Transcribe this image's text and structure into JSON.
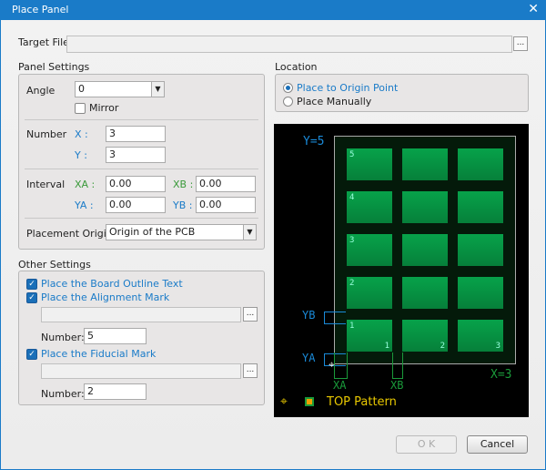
{
  "window": {
    "title": "Place Panel",
    "close": "✕"
  },
  "target_file": {
    "label": "Target File",
    "value": "",
    "browse": "..."
  },
  "panel_settings": {
    "title": "Panel Settings",
    "angle_label": "Angle",
    "angle_value": "0",
    "mirror_label": "Mirror",
    "mirror_checked": false,
    "number_label": "Number",
    "x_label": "X :",
    "x_value": "3",
    "y_label": "Y :",
    "y_value": "3",
    "interval_label": "Interval",
    "xa_label": "XA :",
    "xa_value": "0.00",
    "xb_label": "XB :",
    "xb_value": "0.00",
    "ya_label": "YA :",
    "ya_value": "0.00",
    "yb_label": "YB :",
    "yb_value": "0.00",
    "origin_label": "Placement Origin",
    "origin_value": "Origin of the PCB"
  },
  "other_settings": {
    "title": "Other Settings",
    "board_outline": "Place the Board Outline Text",
    "alignment": "Place the Alignment Mark",
    "alignment_number_label": "Number:",
    "alignment_number": "5",
    "fiducial": "Place the Fiducial Mark",
    "fiducial_number_label": "Number:",
    "fiducial_number": "2",
    "browse": "..."
  },
  "location": {
    "title": "Location",
    "origin": "Place to Origin Point",
    "manual": "Place Manually",
    "selected": "origin"
  },
  "preview": {
    "y_count": "Y=5",
    "x_count": "X=3",
    "row_labels": [
      "5",
      "4",
      "3",
      "2",
      "1"
    ],
    "col_labels": [
      "1",
      "2",
      "3"
    ],
    "xa": "XA",
    "xb": "XB",
    "ya": "YA",
    "yb": "YB",
    "legend": "TOP Pattern"
  },
  "buttons": {
    "ok": "O K",
    "cancel": "Cancel"
  }
}
